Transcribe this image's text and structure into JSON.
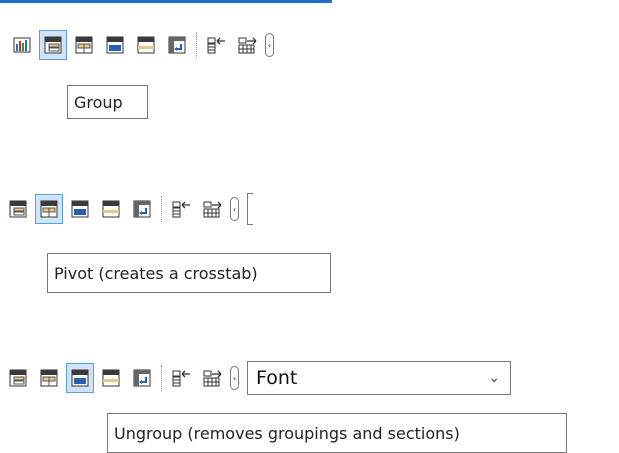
{
  "row1": {
    "tooltip": "Group"
  },
  "row2": {
    "tooltip": "Pivot (creates a crosstab)"
  },
  "row3": {
    "tooltip": "Ungroup (removes groupings and sections)",
    "font_select": {
      "value": "Font"
    }
  },
  "icons": [
    "chart-icon",
    "group-icon",
    "pivot-icon",
    "ungroup-icon",
    "section-icon",
    "swap-icon",
    "move-left-icon",
    "move-right-icon",
    "scroll-icon"
  ],
  "colors": {
    "accent_line": "#1e6fd0",
    "hover_bg": "#cfe4f8",
    "hover_border": "#5b9fe0"
  }
}
